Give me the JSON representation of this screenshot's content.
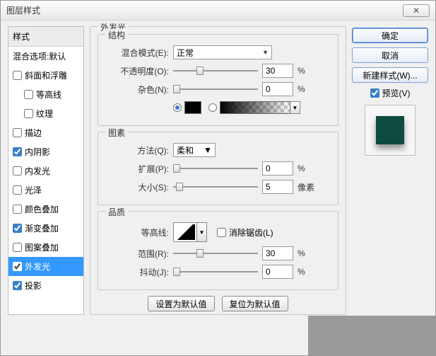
{
  "window": {
    "title": "图层样式",
    "close": "✕"
  },
  "sidebar": {
    "header": "样式",
    "blending": "混合选项:默认",
    "items": [
      {
        "label": "斜面和浮雕",
        "checked": false
      },
      {
        "label": "等高线",
        "checked": false,
        "sub": true
      },
      {
        "label": "纹理",
        "checked": false,
        "sub": true
      },
      {
        "label": "描边",
        "checked": false
      },
      {
        "label": "内阴影",
        "checked": true
      },
      {
        "label": "内发光",
        "checked": false
      },
      {
        "label": "光泽",
        "checked": false
      },
      {
        "label": "颜色叠加",
        "checked": false
      },
      {
        "label": "渐变叠加",
        "checked": true
      },
      {
        "label": "图案叠加",
        "checked": false
      },
      {
        "label": "外发光",
        "checked": true,
        "selected": true
      },
      {
        "label": "投影",
        "checked": true
      }
    ]
  },
  "main": {
    "title": "外发光",
    "structure": {
      "legend": "结构",
      "blend_mode_label": "混合模式(E):",
      "blend_mode_value": "正常",
      "opacity_label": "不透明度(O):",
      "opacity_value": "30",
      "opacity_unit": "%",
      "noise_label": "杂色(N):",
      "noise_value": "0",
      "noise_unit": "%"
    },
    "elements": {
      "legend": "图素",
      "technique_label": "方法(Q):",
      "technique_value": "柔和",
      "spread_label": "扩展(P):",
      "spread_value": "0",
      "spread_unit": "%",
      "size_label": "大小(S):",
      "size_value": "5",
      "size_unit": "像素"
    },
    "quality": {
      "legend": "品质",
      "contour_label": "等高线:",
      "antialias_label": "消除锯齿(L)",
      "range_label": "范围(R):",
      "range_value": "30",
      "range_unit": "%",
      "jitter_label": "抖动(J):",
      "jitter_value": "0",
      "jitter_unit": "%"
    },
    "buttons": {
      "default": "设置为默认值",
      "reset": "复位为默认值"
    }
  },
  "right": {
    "ok": "确定",
    "cancel": "取消",
    "new_style": "新建样式(W)...",
    "preview": "预览(V)"
  }
}
